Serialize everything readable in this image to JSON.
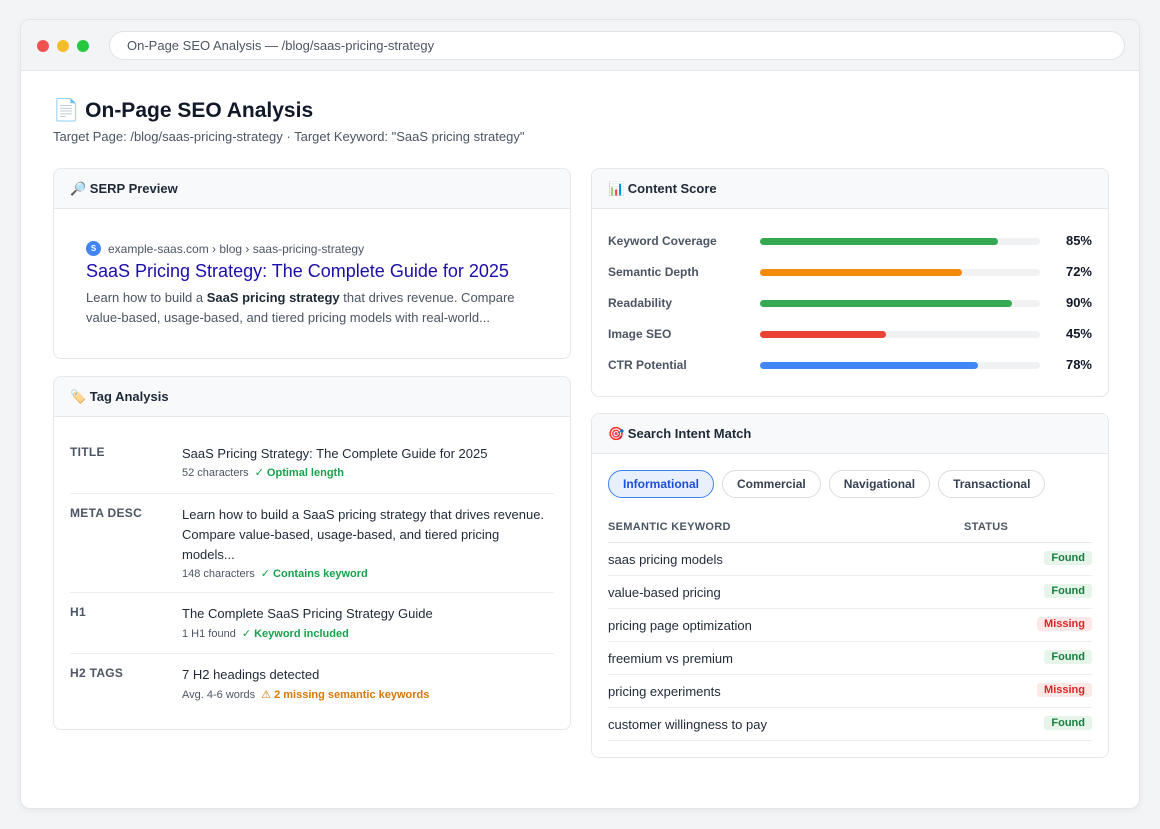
{
  "window": {
    "address": "On-Page SEO Analysis — /blog/saas-pricing-strategy"
  },
  "header": {
    "icon": "📄",
    "title": "On-Page SEO Analysis",
    "subtitle": "Target Page: /blog/saas-pricing-strategy · Target Keyword: \"SaaS pricing strategy\""
  },
  "serp": {
    "heading": "🔎 SERP Preview",
    "favicon_letter": "S",
    "url": "example-saas.com › blog › saas-pricing-strategy",
    "title": "SaaS Pricing Strategy: The Complete Guide for 2025",
    "desc_before": "Learn how to build a ",
    "desc_bold": "SaaS pricing strategy",
    "desc_after": " that drives revenue. Compare value-based, usage-based, and tiered pricing models with real-world..."
  },
  "tags": {
    "heading": "🏷️ Tag Analysis",
    "rows": [
      {
        "label": "TITLE",
        "value": "SaaS Pricing Strategy: The Complete Guide for 2025",
        "meta": "52 characters",
        "status": "✓ Optimal length",
        "status_kind": "ok"
      },
      {
        "label": "META DESC",
        "value": "Learn how to build a SaaS pricing strategy that drives revenue. Compare value-based, usage-based, and tiered pricing models...",
        "meta": "148 characters",
        "status": "✓ Contains keyword",
        "status_kind": "ok"
      },
      {
        "label": "H1",
        "value": "The Complete SaaS Pricing Strategy Guide",
        "meta": "1 H1 found",
        "status": "✓ Keyword included",
        "status_kind": "ok"
      },
      {
        "label": "H2 TAGS",
        "value": "7 H2 headings detected",
        "meta": "Avg. 4-6 words",
        "status": "⚠ 2 missing semantic keywords",
        "status_kind": "warn"
      }
    ]
  },
  "score": {
    "heading": "📊 Content Score",
    "rows": [
      {
        "label": "Keyword Coverage",
        "value": "85%",
        "pct": 85,
        "color": "#34a853"
      },
      {
        "label": "Semantic Depth",
        "value": "72%",
        "pct": 72,
        "color": "#f28b0c"
      },
      {
        "label": "Readability",
        "value": "90%",
        "pct": 90,
        "color": "#34a853"
      },
      {
        "label": "Image SEO",
        "value": "45%",
        "pct": 45,
        "color": "#ea4335"
      },
      {
        "label": "CTR Potential",
        "value": "78%",
        "pct": 78,
        "color": "#4285f4"
      }
    ]
  },
  "intent": {
    "heading": "🎯 Search Intent Match",
    "pills": [
      "Informational",
      "Commercial",
      "Navigational",
      "Transactional"
    ],
    "active_pill": 0,
    "col_keyword": "SEMANTIC KEYWORD",
    "col_status": "STATUS",
    "keywords": [
      {
        "name": "saas pricing models",
        "status": "Found"
      },
      {
        "name": "value-based pricing",
        "status": "Found"
      },
      {
        "name": "pricing page optimization",
        "status": "Missing"
      },
      {
        "name": "freemium vs premium",
        "status": "Found"
      },
      {
        "name": "pricing experiments",
        "status": "Missing"
      },
      {
        "name": "customer willingness to pay",
        "status": "Found"
      }
    ]
  }
}
